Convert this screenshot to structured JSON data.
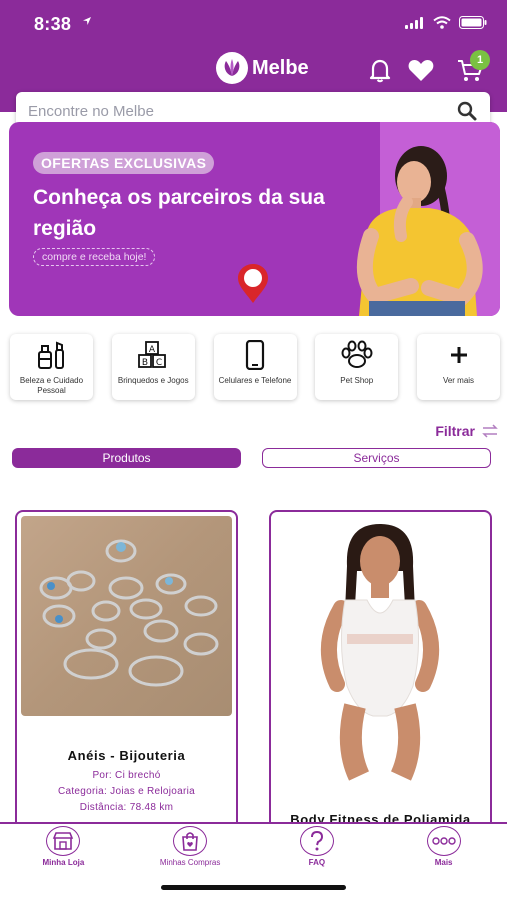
{
  "status_bar": {
    "time": "8:38"
  },
  "header": {
    "logo_text": "Melbe",
    "cart_count": "1",
    "brand_color": "#8b2b9a"
  },
  "search": {
    "placeholder": "Encontre no Melbe"
  },
  "banner": {
    "tag": "OFERTAS EXCLUSIVAS",
    "title": "Conheça os parceiros da sua região",
    "subtitle": "compre e receba hoje!"
  },
  "categories": [
    {
      "label": "Beleza e Cuidado Pessoal",
      "icon": "beauty-icon"
    },
    {
      "label": "Brinquedos e Jogos",
      "icon": "toy-blocks-icon"
    },
    {
      "label": "Celulares e Telefone",
      "icon": "phone-icon"
    },
    {
      "label": "Pet Shop",
      "icon": "paw-icon"
    },
    {
      "label": "Ver mais",
      "icon": "plus-icon"
    }
  ],
  "filter": {
    "label": "Filtrar"
  },
  "tabs": {
    "produtos": "Produtos",
    "servicos": "Serviços"
  },
  "products": [
    {
      "title": "Anéis - Bijouteria",
      "seller": "Por: Ci brechó",
      "category": "Categoria: Joias e Relojoaria",
      "distance": "Distância: 78.48 km"
    },
    {
      "title": "Body Fitness de Poliamida"
    }
  ],
  "bottom_nav": [
    {
      "label": "Minha Loja",
      "icon": "store-icon"
    },
    {
      "label": "Minhas Compras",
      "icon": "shopping-bag-icon"
    },
    {
      "label": "FAQ",
      "icon": "question-icon"
    },
    {
      "label": "Mais",
      "icon": "more-dots-icon"
    }
  ]
}
